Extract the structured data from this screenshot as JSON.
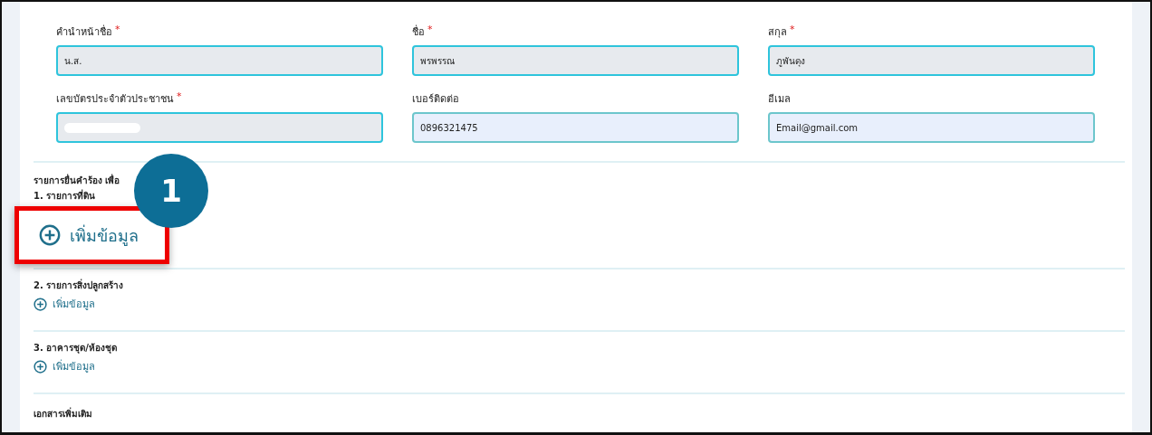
{
  "fields": [
    {
      "label": "คำนำหน้าชื่อ",
      "required_mark": "*",
      "value": "น.ส.",
      "disabled": true,
      "redacted": false
    },
    {
      "label": "ชื่อ",
      "required_mark": "*",
      "value": "พรพรรณ",
      "disabled": true,
      "redacted": false
    },
    {
      "label": "สกุล",
      "required_mark": "*",
      "value": "ภูพันดุง",
      "disabled": true,
      "redacted": false
    },
    {
      "label": "เลขบัตรประจำตัวประชาชน",
      "required_mark": "*",
      "disabled": true,
      "redacted": true
    },
    {
      "label": "เบอร์ติดต่อ",
      "value": "0896321475",
      "disabled": false,
      "redacted": false
    },
    {
      "label": "อีเมล",
      "value": "Email@gmail.com",
      "disabled": false,
      "redacted": false
    }
  ],
  "request_heading": "รายการยื่นคำร้อง เพื่อ",
  "callout": {
    "number": "1"
  },
  "sections": [
    {
      "title": "1. รายการที่ดิน",
      "add_label": "เพิ่มข้อมูล",
      "highlighted": true
    },
    {
      "title": "2. รายการสิ่งปลูกสร้าง",
      "add_label": "เพิ่มข้อมูล",
      "highlighted": false
    },
    {
      "title": "3. อาคารชุด/ห้องชุด",
      "add_label": "เพิ่มข้อมูล",
      "highlighted": false
    }
  ],
  "documents_heading": "เอกสารเพิ่มเติม"
}
